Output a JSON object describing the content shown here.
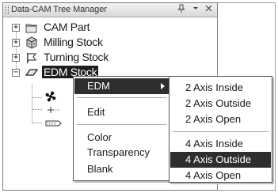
{
  "panel": {
    "title": "Data-CAM Tree Manager",
    "pin_icon": "pin-icon",
    "dropdown_icon": "dropdown-arrow-icon",
    "close_icon": "close-icon"
  },
  "tree": {
    "nodes": [
      {
        "label": "CAM Part",
        "icon": "folder-icon",
        "expander": "+"
      },
      {
        "label": "Milling Stock",
        "icon": "cube-icon",
        "expander": "+"
      },
      {
        "label": "Turning Stock",
        "icon": "lathe-flag-icon",
        "expander": "+"
      },
      {
        "label": "EDM Stock",
        "icon": "edm-plate-icon",
        "expander": "−",
        "selected": true
      }
    ],
    "children": [
      {
        "icon": "fan-blade-icon"
      },
      {
        "icon": "axis-cross-icon"
      },
      {
        "icon": "wire-path-icon"
      }
    ]
  },
  "context_menu": {
    "items": [
      {
        "label": "EDM",
        "has_submenu": true,
        "active": true
      },
      {
        "label": "Edit"
      },
      {
        "label": "Color"
      },
      {
        "label": "Transparency"
      },
      {
        "label": "Blank"
      }
    ]
  },
  "submenu": {
    "items": [
      {
        "label": "2 Axis Inside"
      },
      {
        "label": "2 Axis Outside"
      },
      {
        "label": "2 Axis Open"
      },
      {
        "label": "4 Axis Inside"
      },
      {
        "label": "4 Axis Outside",
        "active": true
      },
      {
        "label": "4 Axis Open"
      }
    ]
  },
  "colors": {
    "highlight": "#2e2e2e",
    "border": "#555555"
  }
}
